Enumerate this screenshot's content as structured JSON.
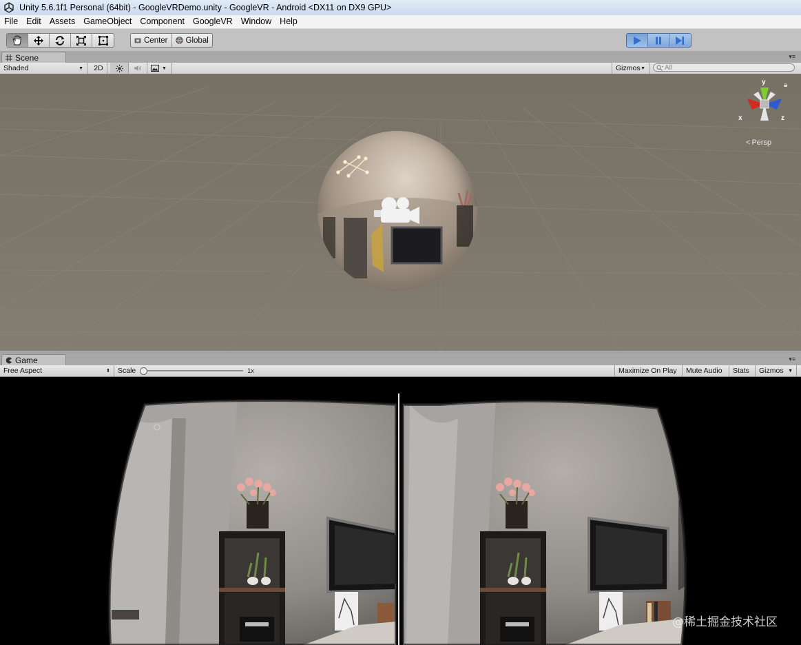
{
  "window": {
    "title": "Unity 5.6.1f1 Personal (64bit) - GoogleVRDemo.unity - GoogleVR - Android <DX11 on DX9 GPU>"
  },
  "menu": [
    "File",
    "Edit",
    "Assets",
    "GameObject",
    "Component",
    "GoogleVR",
    "Window",
    "Help"
  ],
  "toolbar": {
    "pivot_label": "Center",
    "rotation_label": "Global"
  },
  "scene": {
    "tab_label": "Scene",
    "shading_mode": "Shaded",
    "mode_2d": "2D",
    "gizmos_label": "Gizmos",
    "search_placeholder": "All",
    "gizmo": {
      "x": "x",
      "y": "y",
      "z": "z"
    },
    "projection_label": "Persp"
  },
  "game": {
    "tab_label": "Game",
    "aspect": "Free Aspect",
    "scale_label": "Scale",
    "scale_value": "1x",
    "maximize_on_play": "Maximize On Play",
    "mute_audio": "Mute Audio",
    "stats": "Stats",
    "gizmos_label": "Gizmos",
    "watermark": "@稀土掘金技术社区"
  },
  "colors": {
    "play_accent": "#2f6fd0",
    "scene_bg": "#7c766b",
    "axis_x": "#d12a1e",
    "axis_y": "#7ccf2d",
    "axis_z": "#2f5bd1"
  }
}
